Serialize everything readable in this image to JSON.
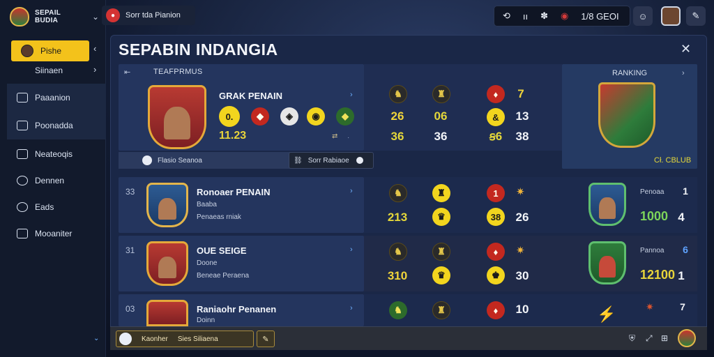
{
  "app": {
    "club_name_line1": "SEPAIL",
    "club_name_line2": "BUDIA"
  },
  "topbar": {
    "left_label": "Sorr tda Pianion",
    "right_glyphs": [
      "⟲",
      "ıı",
      "✽",
      "◉",
      "1/8 GEOI"
    ]
  },
  "sidebar": {
    "items": [
      {
        "label": "Pishe"
      },
      {
        "label": "Siinaen"
      },
      {
        "label": "Paaanion"
      },
      {
        "label": "Poonadda"
      },
      {
        "label": "Neateoqis"
      },
      {
        "label": "Dennen"
      },
      {
        "label": "Eads"
      },
      {
        "label": "Mooaniter"
      }
    ]
  },
  "panel": {
    "title": "SEPABIN INDANGIA",
    "header_label": "TEAFPRMUS",
    "ranking_label": "RANKING",
    "club_value": "Cł. CBLUB"
  },
  "featured": {
    "name": "GRAK PENAIN",
    "rating_badge": "0.",
    "score": "11.23",
    "stat_rows": [
      [
        "26",
        "06",
        "13"
      ],
      [
        "36",
        "36",
        "38"
      ]
    ],
    "top_value": "7",
    "toggle_left": "Flasio Seanoa",
    "toggle_right": "Sorr Rabiaoe"
  },
  "rows": [
    {
      "num": "33",
      "name": "Ronoaer PENAIN",
      "sub1": "Baaba",
      "sub2": "Penaeas rniak",
      "top4": "",
      "stats": [
        "213",
        "",
        "38",
        "26"
      ],
      "side_label": "Penoaa",
      "side_num_top": "1",
      "side_value": "1000",
      "side_num": "4"
    },
    {
      "num": "31",
      "name": "OUE SEIGE",
      "sub1": "Doone",
      "sub2": "Beneae Peraena",
      "top4": "",
      "stats": [
        "310",
        "",
        "",
        "30"
      ],
      "side_label": "Pannoa",
      "side_num_top": "6",
      "side_value": "12100",
      "side_num": "1"
    },
    {
      "num": "03",
      "name": "Raniaohr Penanen",
      "sub1": "Doinn",
      "sub2": "",
      "top4": "10",
      "stats": [
        "",
        "",
        "",
        ""
      ],
      "side_label": "",
      "side_num_top": "7",
      "side_value": "",
      "side_num": ""
    }
  ],
  "bottom": {
    "left_text": "Kaonher",
    "field_text": "Sies Siliaena"
  }
}
